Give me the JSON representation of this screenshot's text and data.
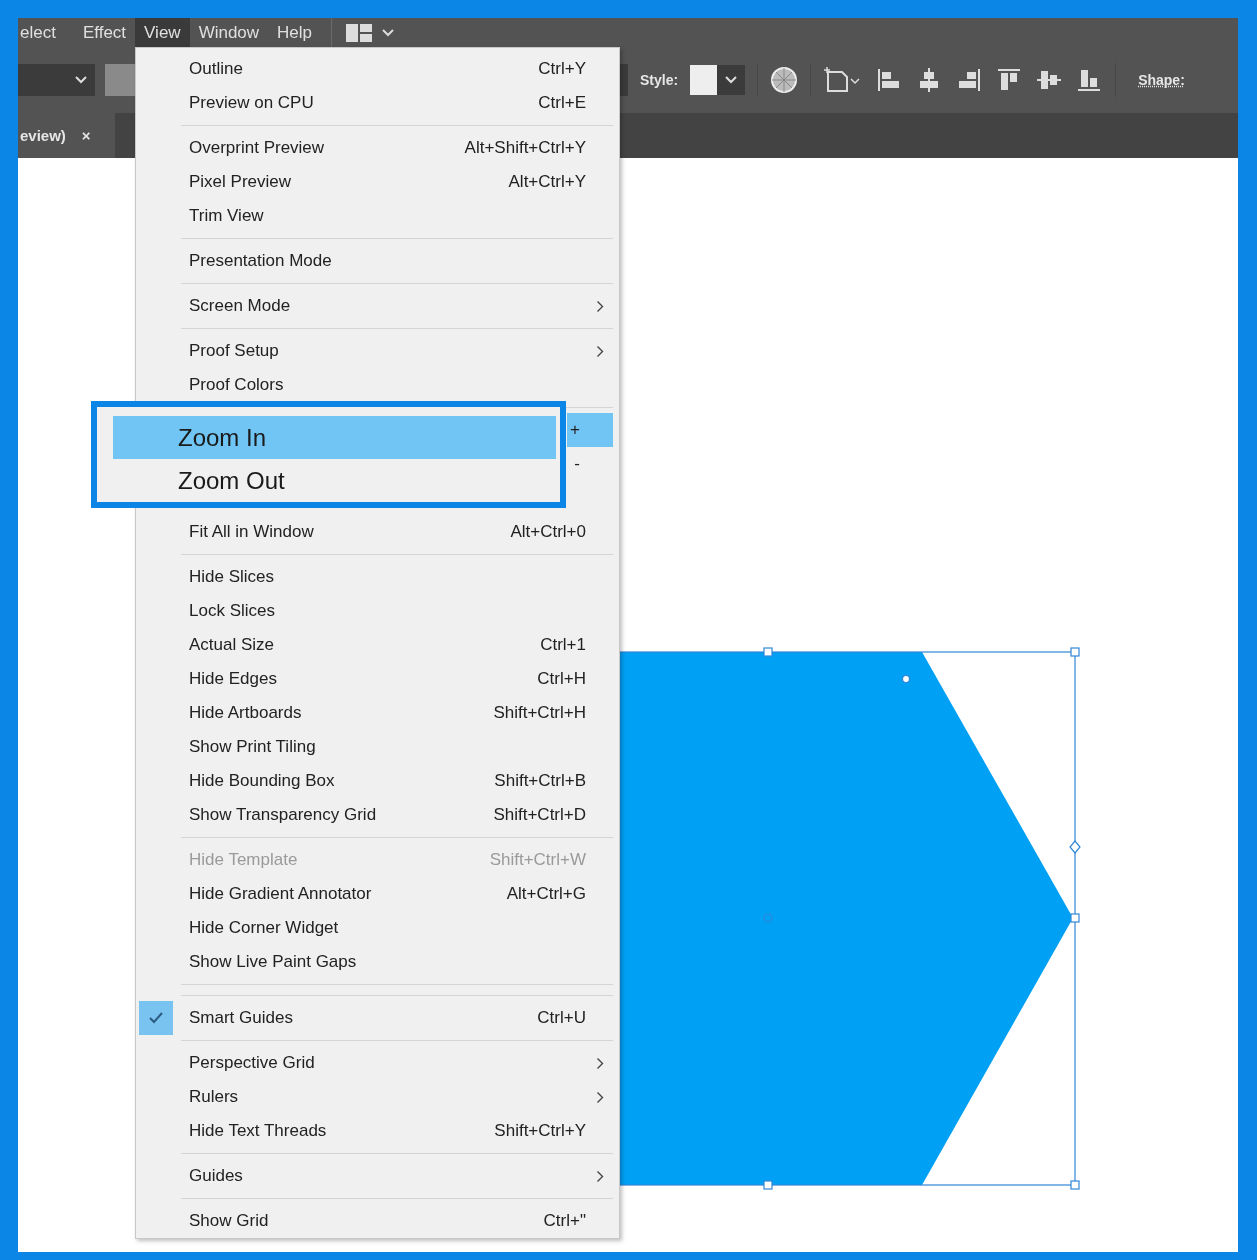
{
  "menubar": [
    {
      "label": "elect",
      "selected": false
    },
    {
      "label": "Effect",
      "selected": false
    },
    {
      "label": "View",
      "selected": true
    },
    {
      "label": "Window",
      "selected": false
    },
    {
      "label": "Help",
      "selected": false
    }
  ],
  "control_bar": {
    "style_label": "Style:",
    "shape_label": "Shape:"
  },
  "document_tab": {
    "title": "eview)",
    "close": "×"
  },
  "view_menu": {
    "items": [
      {
        "kind": "item",
        "label": "Outline",
        "shortcut": "Ctrl+Y",
        "submenu": false,
        "checked": false,
        "disabled": false
      },
      {
        "kind": "item",
        "label": "Preview on CPU",
        "shortcut": "Ctrl+E",
        "submenu": false,
        "checked": false,
        "disabled": false
      },
      {
        "kind": "separator"
      },
      {
        "kind": "item",
        "label": "Overprint Preview",
        "shortcut": "Alt+Shift+Ctrl+Y",
        "submenu": false,
        "checked": false,
        "disabled": false
      },
      {
        "kind": "item",
        "label": "Pixel Preview",
        "shortcut": "Alt+Ctrl+Y",
        "submenu": false,
        "checked": false,
        "disabled": false
      },
      {
        "kind": "item",
        "label": "Trim View",
        "submenu": false,
        "checked": false,
        "disabled": false
      },
      {
        "kind": "separator"
      },
      {
        "kind": "item",
        "label": "Presentation Mode",
        "submenu": false,
        "checked": false,
        "disabled": false
      },
      {
        "kind": "separator"
      },
      {
        "kind": "item",
        "label": "Screen Mode",
        "submenu": true,
        "checked": false,
        "disabled": false
      },
      {
        "kind": "separator"
      },
      {
        "kind": "item",
        "label": "Proof Setup",
        "submenu": true,
        "checked": false,
        "disabled": false
      },
      {
        "kind": "item",
        "label": "Proof Colors",
        "submenu": false,
        "checked": false,
        "disabled": false
      },
      {
        "kind": "separator"
      },
      {
        "kind": "zoom",
        "label": "Zoom In",
        "shortcut": "+",
        "selected": true
      },
      {
        "kind": "zoom",
        "label": "Zoom Out",
        "shortcut": "-",
        "selected": false
      },
      {
        "kind": "item",
        "label": "Fit All in Window",
        "shortcut": "Alt+Ctrl+0",
        "submenu": false,
        "checked": false,
        "disabled": false
      },
      {
        "kind": "separator"
      },
      {
        "kind": "item",
        "label": "Hide Slices",
        "submenu": false,
        "checked": false,
        "disabled": false
      },
      {
        "kind": "item",
        "label": "Lock Slices",
        "submenu": false,
        "checked": false,
        "disabled": false
      },
      {
        "kind": "item",
        "label": "Actual Size",
        "shortcut": "Ctrl+1",
        "submenu": false,
        "checked": false,
        "disabled": false
      },
      {
        "kind": "item",
        "label": "Hide Edges",
        "shortcut": "Ctrl+H",
        "submenu": false,
        "checked": false,
        "disabled": false
      },
      {
        "kind": "item",
        "label": "Hide Artboards",
        "shortcut": "Shift+Ctrl+H",
        "submenu": false,
        "checked": false,
        "disabled": false
      },
      {
        "kind": "item",
        "label": "Show Print Tiling",
        "submenu": false,
        "checked": false,
        "disabled": false
      },
      {
        "kind": "item",
        "label": "Hide Bounding Box",
        "shortcut": "Shift+Ctrl+B",
        "submenu": false,
        "checked": false,
        "disabled": false
      },
      {
        "kind": "item",
        "label": "Show Transparency Grid",
        "shortcut": "Shift+Ctrl+D",
        "submenu": false,
        "checked": false,
        "disabled": false
      },
      {
        "kind": "separator"
      },
      {
        "kind": "item",
        "label": "Hide Template",
        "shortcut": "Shift+Ctrl+W",
        "submenu": false,
        "checked": false,
        "disabled": true
      },
      {
        "kind": "item",
        "label": "Hide Gradient Annotator",
        "shortcut": "Alt+Ctrl+G",
        "submenu": false,
        "checked": false,
        "disabled": false
      },
      {
        "kind": "item",
        "label": "Hide Corner Widget",
        "submenu": false,
        "checked": false,
        "disabled": false
      },
      {
        "kind": "item",
        "label": "Show Live Paint Gaps",
        "submenu": false,
        "checked": false,
        "disabled": false
      },
      {
        "kind": "separator"
      },
      {
        "kind": "separator"
      },
      {
        "kind": "item",
        "label": "Smart Guides",
        "shortcut": "Ctrl+U",
        "submenu": false,
        "checked": true,
        "disabled": false
      },
      {
        "kind": "separator"
      },
      {
        "kind": "item",
        "label": "Perspective Grid",
        "submenu": true,
        "checked": false,
        "disabled": false
      },
      {
        "kind": "item",
        "label": "Rulers",
        "submenu": true,
        "checked": false,
        "disabled": false
      },
      {
        "kind": "item",
        "label": "Hide Text Threads",
        "shortcut": "Shift+Ctrl+Y",
        "submenu": false,
        "checked": false,
        "disabled": false
      },
      {
        "kind": "separator"
      },
      {
        "kind": "item",
        "label": "Guides",
        "submenu": true,
        "checked": false,
        "disabled": false
      },
      {
        "kind": "separator"
      },
      {
        "kind": "item",
        "label": "Show Grid",
        "shortcut": "Ctrl+\"",
        "submenu": false,
        "checked": false,
        "disabled": false
      }
    ]
  }
}
